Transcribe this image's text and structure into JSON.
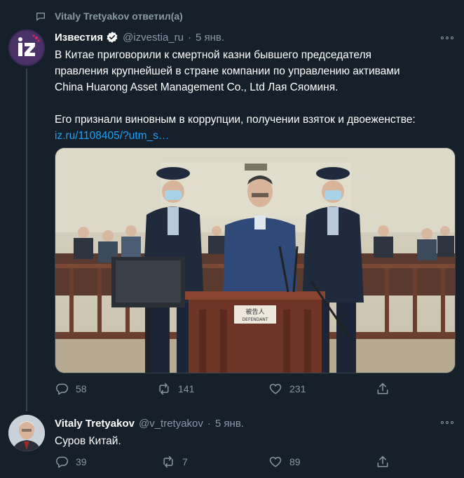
{
  "retweet_bar": {
    "text": "Vitaly Tretyakov ответил(а)"
  },
  "tweets": [
    {
      "display_name": "Известия",
      "handle": "@izvestia_ru",
      "separator": "·",
      "time": "5 янв.",
      "avatar_text": "iz",
      "text_lines": [
        "В Китае приговорили к смертной казни бывшего председателя",
        "правления крупнейшей в стране компании по управлению активами",
        "China Huarong Asset Management Co., Ltd Лая Сяоминя.",
        "",
        "Его признали виновным в коррупции, получении взяток и двоеженстве:"
      ],
      "link": "iz.ru/1108405/?utm_s…",
      "media_sign": "被告人\nDEFENDANT",
      "replies": "58",
      "retweets": "141",
      "likes": "231"
    },
    {
      "display_name": "Vitaly Tretyakov",
      "handle": "@v_tretyakov",
      "separator": "·",
      "time": "5 янв.",
      "text": "Суров Китай.",
      "replies": "39",
      "retweets": "7",
      "likes": "89"
    }
  ],
  "colors": {
    "background": "#15202b",
    "secondary": "#8899a6",
    "link": "#1da1f2",
    "border": "#38444d"
  }
}
